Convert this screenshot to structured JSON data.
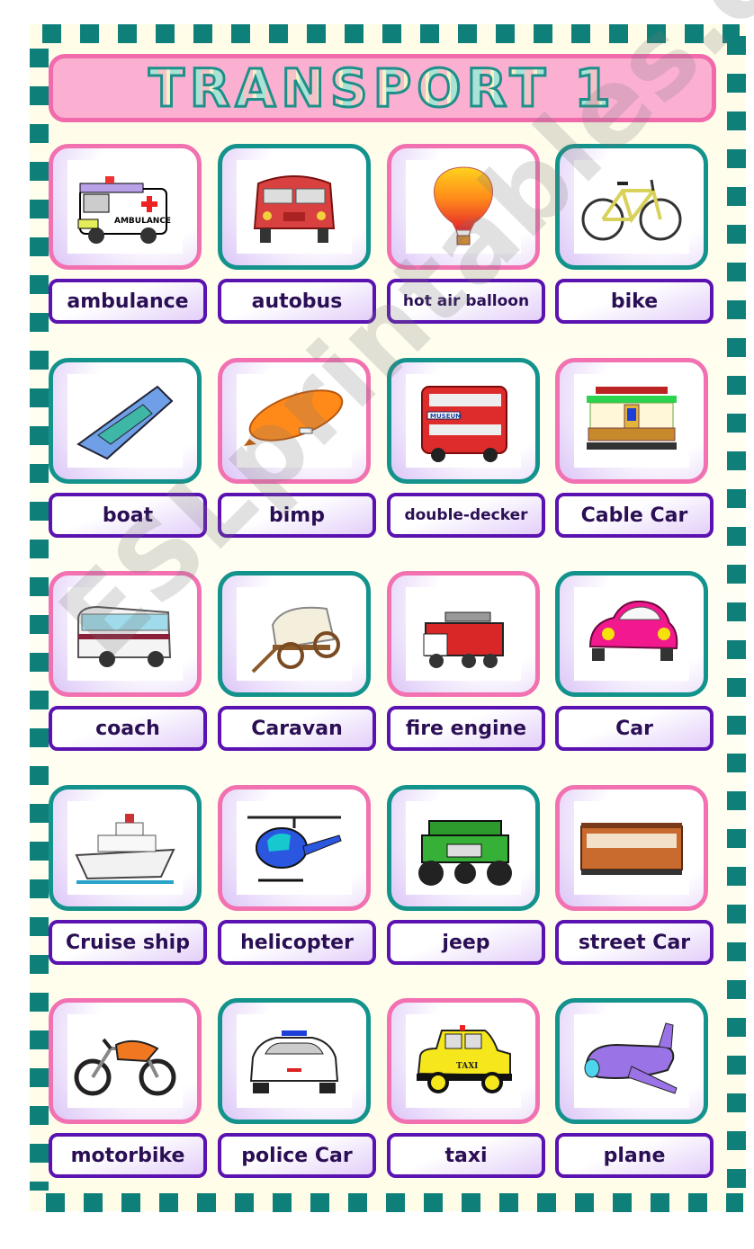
{
  "title": "TRANSPORT 1",
  "watermark": "ESLprintables.com",
  "colors": {
    "frame_dots": "#0f8079",
    "title_border": "#f16aab",
    "title_fill": "#fbb0d2",
    "card_pink": "#f272b1",
    "card_teal": "#13938c",
    "label_border": "#5a12b0",
    "label_text": "#2b0f55"
  },
  "rows": [
    {
      "cards": [
        {
          "label": "ambulance",
          "icon": "ambulance-icon",
          "frame": "pink"
        },
        {
          "label": "autobus",
          "icon": "autobus-icon",
          "frame": "teal"
        },
        {
          "label": "hot air balloon",
          "icon": "hot-air-balloon-icon",
          "frame": "pink"
        },
        {
          "label": "bike",
          "icon": "bike-icon",
          "frame": "teal"
        }
      ]
    },
    {
      "cards": [
        {
          "label": "boat",
          "icon": "boat-icon",
          "frame": "teal"
        },
        {
          "label": "bimp",
          "icon": "blimp-icon",
          "frame": "pink"
        },
        {
          "label": "double-decker",
          "icon": "double-decker-icon",
          "frame": "teal"
        },
        {
          "label": "Cable Car",
          "icon": "cable-car-icon",
          "frame": "pink"
        }
      ]
    },
    {
      "cards": [
        {
          "label": "coach",
          "icon": "coach-icon",
          "frame": "pink"
        },
        {
          "label": "Caravan",
          "icon": "caravan-icon",
          "frame": "teal"
        },
        {
          "label": "fire engine",
          "icon": "fire-engine-icon",
          "frame": "pink"
        },
        {
          "label": "Car",
          "icon": "car-icon",
          "frame": "teal"
        }
      ]
    },
    {
      "cards": [
        {
          "label": "Cruise ship",
          "icon": "cruise-ship-icon",
          "frame": "teal"
        },
        {
          "label": "helicopter",
          "icon": "helicopter-icon",
          "frame": "pink"
        },
        {
          "label": "jeep",
          "icon": "jeep-icon",
          "frame": "teal"
        },
        {
          "label": "street Car",
          "icon": "street-car-icon",
          "frame": "pink"
        }
      ]
    },
    {
      "cards": [
        {
          "label": "motorbike",
          "icon": "motorbike-icon",
          "frame": "pink"
        },
        {
          "label": "police Car",
          "icon": "police-car-icon",
          "frame": "teal"
        },
        {
          "label": "taxi",
          "icon": "taxi-icon",
          "frame": "pink"
        },
        {
          "label": "plane",
          "icon": "plane-icon",
          "frame": "teal"
        }
      ]
    }
  ],
  "image_text": {
    "ambulance_sign": "AMBULANCE",
    "bus_sign": "MUSEUM",
    "taxi_sign": "TAXI"
  }
}
